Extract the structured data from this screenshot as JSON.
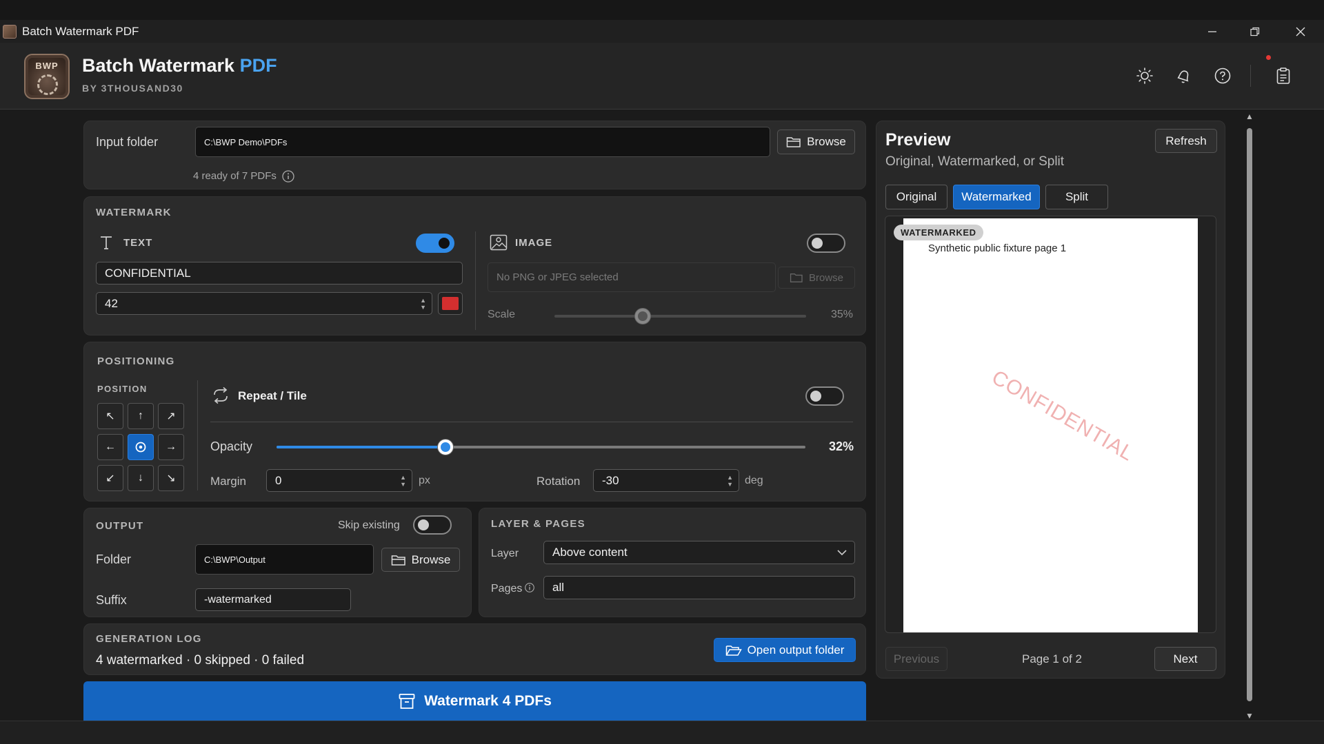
{
  "window": {
    "title": "Batch Watermark PDF"
  },
  "header": {
    "logo_text": "BWP",
    "title_main": "Batch Watermark",
    "title_accent": "PDF",
    "subtitle": "BY 3THOUSAND30",
    "accent_color": "#4aa3f0"
  },
  "input": {
    "label": "Input folder",
    "path": "C:\\BWP Demo\\PDFs",
    "browse_label": "Browse",
    "status": "4 ready of 7 PDFs"
  },
  "watermark": {
    "section": "WATERMARK",
    "text": {
      "label": "TEXT",
      "enabled": true,
      "value": "CONFIDENTIAL",
      "size": "42",
      "color": "#d32f2f"
    },
    "image": {
      "label": "IMAGE",
      "enabled": false,
      "placeholder": "No PNG or JPEG selected",
      "browse_label": "Browse",
      "scale_label": "Scale",
      "scale_value": "35%",
      "scale_fraction": 0.35
    }
  },
  "positioning": {
    "section": "POSITIONING",
    "position_label": "POSITION",
    "grid": [
      "↖",
      "↑",
      "↗",
      "←",
      "center",
      "→",
      "↙",
      "↓",
      "↘"
    ],
    "selected": "center",
    "repeat_label": "Repeat / Tile",
    "repeat_enabled": false,
    "opacity_label": "Opacity",
    "opacity_value": "32%",
    "opacity_fraction": 0.32,
    "margin_label": "Margin",
    "margin_value": "0",
    "margin_unit": "px",
    "rotation_label": "Rotation",
    "rotation_value": "-30",
    "rotation_unit": "deg"
  },
  "output": {
    "section": "OUTPUT",
    "skip_label": "Skip existing",
    "skip_enabled": false,
    "folder_label": "Folder",
    "folder_value": "C:\\BWP\\Output",
    "browse_label": "Browse",
    "suffix_label": "Suffix",
    "suffix_value": "-watermarked"
  },
  "layer_pages": {
    "section": "LAYER & PAGES",
    "layer_label": "Layer",
    "layer_value": "Above content",
    "pages_label": "Pages",
    "pages_value": "all"
  },
  "log": {
    "section": "GENERATION LOG",
    "summary": "4 watermarked · 0 skipped · 0 failed",
    "open_label": "Open output folder"
  },
  "action": {
    "label": "Watermark 4 PDFs"
  },
  "preview": {
    "title": "Preview",
    "subtitle": "Original, Watermarked, or Split",
    "refresh_label": "Refresh",
    "tabs": [
      "Original",
      "Watermarked",
      "Split"
    ],
    "active_tab": "Watermarked",
    "badge": "WATERMARKED",
    "page_text": "Synthetic public fixture page 1",
    "watermark_text": "CONFIDENTIAL",
    "prev_label": "Previous",
    "page_indicator": "Page 1 of 2",
    "next_label": "Next"
  }
}
